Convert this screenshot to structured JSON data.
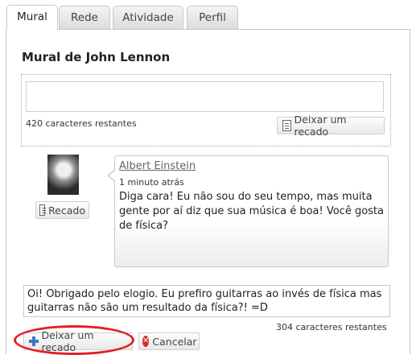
{
  "tabs": [
    {
      "label": "Mural",
      "active": true
    },
    {
      "label": "Rede",
      "active": false
    },
    {
      "label": "Atividade",
      "active": false
    },
    {
      "label": "Perfil",
      "active": false
    }
  ],
  "title": "Mural de John Lennon",
  "composer": {
    "counter": "420 caracteres restantes",
    "button_label": "Deixar um recado"
  },
  "post": {
    "author": "Albert Einstein",
    "time": "1 minuto atrás",
    "message": "Diga cara! Eu não sou do seu tempo, mas muita gente por aí diz que sua música é boa! Você gosta de física?",
    "recado_button": "Recado"
  },
  "reply": {
    "text": "Oi! Obrigado pelo elogio. Eu prefiro guitarras ao invés de física mas guitarras não são um resultado da física?!  =D",
    "counter": "304 caracteres restantes",
    "submit_label": "Deixar um recado",
    "cancel_label": "Cancelar"
  },
  "colors": {
    "highlight_ring": "#e31e24",
    "link": "#666666"
  }
}
